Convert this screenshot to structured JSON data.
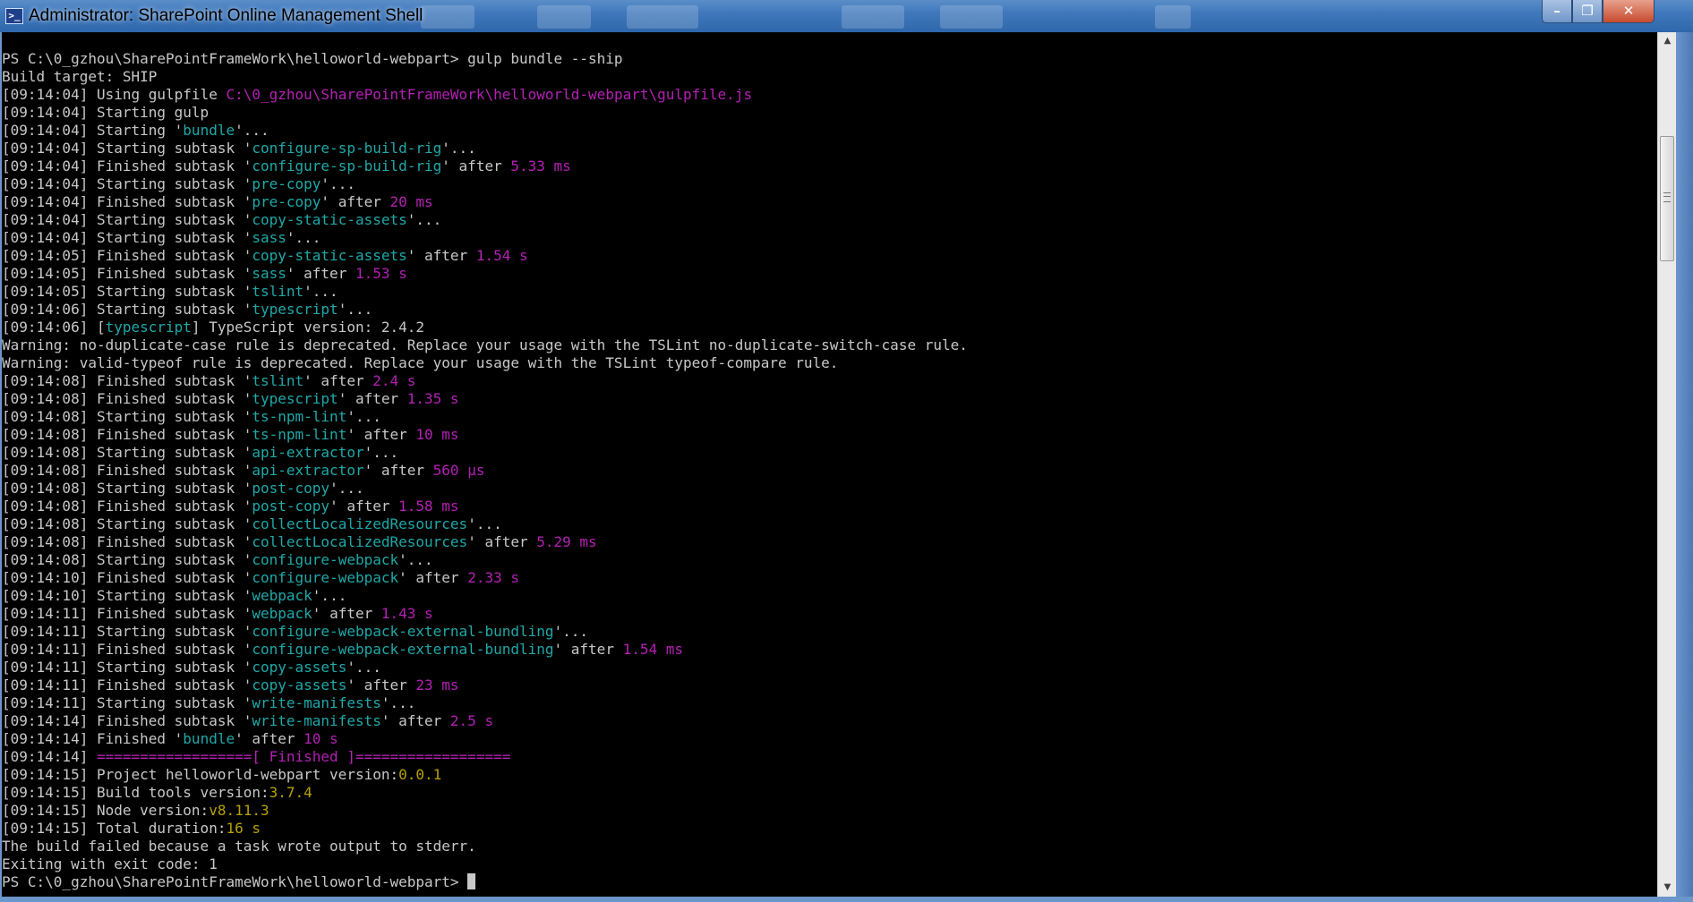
{
  "window": {
    "title": "Administrator: SharePoint Online Management Shell",
    "icon_glyph": ">_",
    "minimize_glyph": "–",
    "maximize_glyph": "❐",
    "close_glyph": "✕"
  },
  "colors": {
    "background": "#000000",
    "text": "#c8c8c8",
    "cyan": "#1fa8a8",
    "magenta": "#b420b4",
    "yellow": "#b8a000"
  },
  "scrollbar": {
    "up_glyph": "▲",
    "down_glyph": "▼"
  },
  "console": {
    "lines": [
      [
        {
          "t": "PS C:\\0_gzhou\\SharePointFrameWork\\helloworld-webpart> gulp bundle --ship",
          "c": "gray"
        }
      ],
      [
        {
          "t": "Build target: SHIP",
          "c": "gray"
        }
      ],
      [
        {
          "t": "[",
          "c": "gray"
        },
        {
          "t": "09:14:04",
          "c": "gray"
        },
        {
          "t": "] Using gulpfile ",
          "c": "gray"
        },
        {
          "t": "C:\\0_gzhou\\SharePointFrameWork\\helloworld-webpart\\gulpfile.js",
          "c": "magenta"
        }
      ],
      [
        {
          "t": "[09:14:04] Starting gulp",
          "c": "gray"
        }
      ],
      [
        {
          "t": "[09:14:04] Starting '",
          "c": "gray"
        },
        {
          "t": "bundle",
          "c": "cyan"
        },
        {
          "t": "'...",
          "c": "gray"
        }
      ],
      [
        {
          "t": "[09:14:04] Starting subtask '",
          "c": "gray"
        },
        {
          "t": "configure-sp-build-rig",
          "c": "cyan"
        },
        {
          "t": "'...",
          "c": "gray"
        }
      ],
      [
        {
          "t": "[09:14:04] Finished subtask '",
          "c": "gray"
        },
        {
          "t": "configure-sp-build-rig",
          "c": "cyan"
        },
        {
          "t": "' after ",
          "c": "gray"
        },
        {
          "t": "5.33 ms",
          "c": "magenta"
        }
      ],
      [
        {
          "t": "[09:14:04] Starting subtask '",
          "c": "gray"
        },
        {
          "t": "pre-copy",
          "c": "cyan"
        },
        {
          "t": "'...",
          "c": "gray"
        }
      ],
      [
        {
          "t": "[09:14:04] Finished subtask '",
          "c": "gray"
        },
        {
          "t": "pre-copy",
          "c": "cyan"
        },
        {
          "t": "' after ",
          "c": "gray"
        },
        {
          "t": "20 ms",
          "c": "magenta"
        }
      ],
      [
        {
          "t": "[09:14:04] Starting subtask '",
          "c": "gray"
        },
        {
          "t": "copy-static-assets",
          "c": "cyan"
        },
        {
          "t": "'...",
          "c": "gray"
        }
      ],
      [
        {
          "t": "[09:14:04] Starting subtask '",
          "c": "gray"
        },
        {
          "t": "sass",
          "c": "cyan"
        },
        {
          "t": "'...",
          "c": "gray"
        }
      ],
      [
        {
          "t": "[09:14:05] Finished subtask '",
          "c": "gray"
        },
        {
          "t": "copy-static-assets",
          "c": "cyan"
        },
        {
          "t": "' after ",
          "c": "gray"
        },
        {
          "t": "1.54 s",
          "c": "magenta"
        }
      ],
      [
        {
          "t": "[09:14:05] Finished subtask '",
          "c": "gray"
        },
        {
          "t": "sass",
          "c": "cyan"
        },
        {
          "t": "' after ",
          "c": "gray"
        },
        {
          "t": "1.53 s",
          "c": "magenta"
        }
      ],
      [
        {
          "t": "[09:14:05] Starting subtask '",
          "c": "gray"
        },
        {
          "t": "tslint",
          "c": "cyan"
        },
        {
          "t": "'...",
          "c": "gray"
        }
      ],
      [
        {
          "t": "[09:14:06] Starting subtask '",
          "c": "gray"
        },
        {
          "t": "typescript",
          "c": "cyan"
        },
        {
          "t": "'...",
          "c": "gray"
        }
      ],
      [
        {
          "t": "[09:14:06] [",
          "c": "gray"
        },
        {
          "t": "typescript",
          "c": "cyan"
        },
        {
          "t": "] TypeScript version: 2.4.2",
          "c": "gray"
        }
      ],
      [
        {
          "t": "Warning: no-duplicate-case rule is deprecated. Replace your usage with the TSLint no-duplicate-switch-case rule.",
          "c": "gray"
        }
      ],
      [
        {
          "t": "Warning: valid-typeof rule is deprecated. Replace your usage with the TSLint typeof-compare rule.",
          "c": "gray"
        }
      ],
      [
        {
          "t": "[09:14:08] Finished subtask '",
          "c": "gray"
        },
        {
          "t": "tslint",
          "c": "cyan"
        },
        {
          "t": "' after ",
          "c": "gray"
        },
        {
          "t": "2.4 s",
          "c": "magenta"
        }
      ],
      [
        {
          "t": "[09:14:08] Finished subtask '",
          "c": "gray"
        },
        {
          "t": "typescript",
          "c": "cyan"
        },
        {
          "t": "' after ",
          "c": "gray"
        },
        {
          "t": "1.35 s",
          "c": "magenta"
        }
      ],
      [
        {
          "t": "[09:14:08] Starting subtask '",
          "c": "gray"
        },
        {
          "t": "ts-npm-lint",
          "c": "cyan"
        },
        {
          "t": "'...",
          "c": "gray"
        }
      ],
      [
        {
          "t": "[09:14:08] Finished subtask '",
          "c": "gray"
        },
        {
          "t": "ts-npm-lint",
          "c": "cyan"
        },
        {
          "t": "' after ",
          "c": "gray"
        },
        {
          "t": "10 ms",
          "c": "magenta"
        }
      ],
      [
        {
          "t": "[09:14:08] Starting subtask '",
          "c": "gray"
        },
        {
          "t": "api-extractor",
          "c": "cyan"
        },
        {
          "t": "'...",
          "c": "gray"
        }
      ],
      [
        {
          "t": "[09:14:08] Finished subtask '",
          "c": "gray"
        },
        {
          "t": "api-extractor",
          "c": "cyan"
        },
        {
          "t": "' after ",
          "c": "gray"
        },
        {
          "t": "560 μs",
          "c": "magenta"
        }
      ],
      [
        {
          "t": "[09:14:08] Starting subtask '",
          "c": "gray"
        },
        {
          "t": "post-copy",
          "c": "cyan"
        },
        {
          "t": "'...",
          "c": "gray"
        }
      ],
      [
        {
          "t": "[09:14:08] Finished subtask '",
          "c": "gray"
        },
        {
          "t": "post-copy",
          "c": "cyan"
        },
        {
          "t": "' after ",
          "c": "gray"
        },
        {
          "t": "1.58 ms",
          "c": "magenta"
        }
      ],
      [
        {
          "t": "[09:14:08] Starting subtask '",
          "c": "gray"
        },
        {
          "t": "collectLocalizedResources",
          "c": "cyan"
        },
        {
          "t": "'...",
          "c": "gray"
        }
      ],
      [
        {
          "t": "[09:14:08] Finished subtask '",
          "c": "gray"
        },
        {
          "t": "collectLocalizedResources",
          "c": "cyan"
        },
        {
          "t": "' after ",
          "c": "gray"
        },
        {
          "t": "5.29 ms",
          "c": "magenta"
        }
      ],
      [
        {
          "t": "[09:14:08] Starting subtask '",
          "c": "gray"
        },
        {
          "t": "configure-webpack",
          "c": "cyan"
        },
        {
          "t": "'...",
          "c": "gray"
        }
      ],
      [
        {
          "t": "[09:14:10] Finished subtask '",
          "c": "gray"
        },
        {
          "t": "configure-webpack",
          "c": "cyan"
        },
        {
          "t": "' after ",
          "c": "gray"
        },
        {
          "t": "2.33 s",
          "c": "magenta"
        }
      ],
      [
        {
          "t": "[09:14:10] Starting subtask '",
          "c": "gray"
        },
        {
          "t": "webpack",
          "c": "cyan"
        },
        {
          "t": "'...",
          "c": "gray"
        }
      ],
      [
        {
          "t": "[09:14:11] Finished subtask '",
          "c": "gray"
        },
        {
          "t": "webpack",
          "c": "cyan"
        },
        {
          "t": "' after ",
          "c": "gray"
        },
        {
          "t": "1.43 s",
          "c": "magenta"
        }
      ],
      [
        {
          "t": "[09:14:11] Starting subtask '",
          "c": "gray"
        },
        {
          "t": "configure-webpack-external-bundling",
          "c": "cyan"
        },
        {
          "t": "'...",
          "c": "gray"
        }
      ],
      [
        {
          "t": "[09:14:11] Finished subtask '",
          "c": "gray"
        },
        {
          "t": "configure-webpack-external-bundling",
          "c": "cyan"
        },
        {
          "t": "' after ",
          "c": "gray"
        },
        {
          "t": "1.54 ms",
          "c": "magenta"
        }
      ],
      [
        {
          "t": "[09:14:11] Starting subtask '",
          "c": "gray"
        },
        {
          "t": "copy-assets",
          "c": "cyan"
        },
        {
          "t": "'...",
          "c": "gray"
        }
      ],
      [
        {
          "t": "[09:14:11] Finished subtask '",
          "c": "gray"
        },
        {
          "t": "copy-assets",
          "c": "cyan"
        },
        {
          "t": "' after ",
          "c": "gray"
        },
        {
          "t": "23 ms",
          "c": "magenta"
        }
      ],
      [
        {
          "t": "[09:14:11] Starting subtask '",
          "c": "gray"
        },
        {
          "t": "write-manifests",
          "c": "cyan"
        },
        {
          "t": "'...",
          "c": "gray"
        }
      ],
      [
        {
          "t": "[09:14:14] Finished subtask '",
          "c": "gray"
        },
        {
          "t": "write-manifests",
          "c": "cyan"
        },
        {
          "t": "' after ",
          "c": "gray"
        },
        {
          "t": "2.5 s",
          "c": "magenta"
        }
      ],
      [
        {
          "t": "[09:14:14] Finished '",
          "c": "gray"
        },
        {
          "t": "bundle",
          "c": "cyan"
        },
        {
          "t": "' after ",
          "c": "gray"
        },
        {
          "t": "10 s",
          "c": "magenta"
        }
      ],
      [
        {
          "t": "[09:14:14] ",
          "c": "gray"
        },
        {
          "t": "==================[ Finished ]==================",
          "c": "magenta"
        }
      ],
      [
        {
          "t": "[09:14:15] Project helloworld-webpart version:",
          "c": "gray"
        },
        {
          "t": "0.0.1",
          "c": "yellow"
        }
      ],
      [
        {
          "t": "[09:14:15] Build tools version:",
          "c": "gray"
        },
        {
          "t": "3.7.4",
          "c": "yellow"
        }
      ],
      [
        {
          "t": "[09:14:15] Node version:",
          "c": "gray"
        },
        {
          "t": "v8.11.3",
          "c": "yellow"
        }
      ],
      [
        {
          "t": "[09:14:15] Total duration:",
          "c": "gray"
        },
        {
          "t": "16 s",
          "c": "yellow"
        }
      ],
      [
        {
          "t": "The build failed because a task wrote output to stderr.",
          "c": "gray"
        }
      ],
      [
        {
          "t": "Exiting with exit code: 1",
          "c": "gray"
        }
      ],
      [
        {
          "t": "PS C:\\0_gzhou\\SharePointFrameWork\\helloworld-webpart> ",
          "c": "gray"
        }
      ]
    ]
  }
}
